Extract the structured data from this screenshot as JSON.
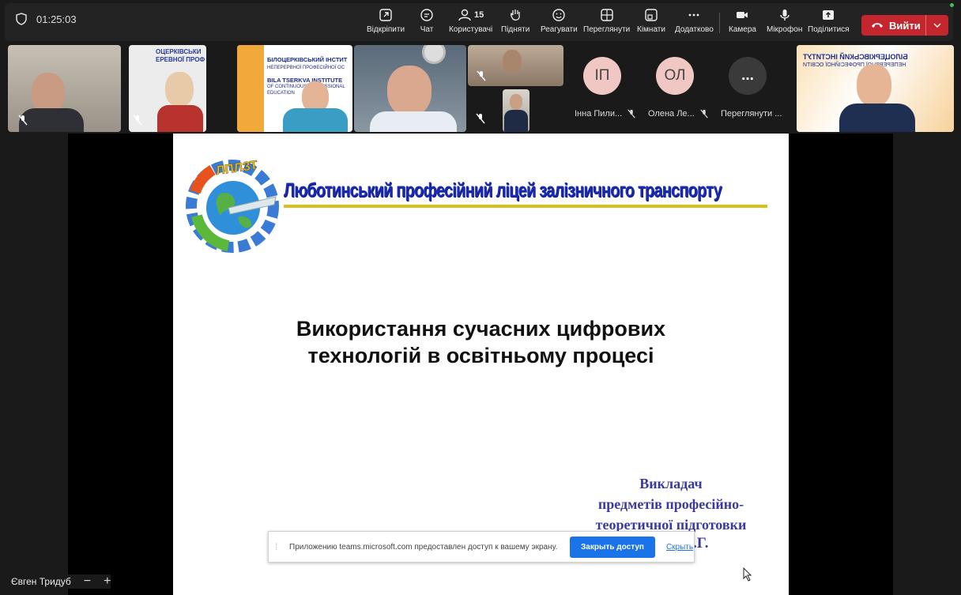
{
  "meeting": {
    "timer": "01:25:03"
  },
  "toolbar": {
    "items": [
      {
        "label": "Відкріпити",
        "icon": "popout-icon"
      },
      {
        "label": "Чат",
        "icon": "chat-icon"
      },
      {
        "label": "Користувачі",
        "icon": "people-icon",
        "badge": "15"
      },
      {
        "label": "Підняти",
        "icon": "raise-hand-icon"
      },
      {
        "label": "Реагувати",
        "icon": "react-icon"
      },
      {
        "label": "Переглянути",
        "icon": "view-icon"
      },
      {
        "label": "Кімнати",
        "icon": "rooms-icon"
      },
      {
        "label": "Додатково",
        "icon": "more-icon"
      },
      {
        "label": "Камера",
        "icon": "camera-icon"
      },
      {
        "label": "Мікрофон",
        "icon": "microphone-icon"
      },
      {
        "label": "Поділитися",
        "icon": "share-icon"
      }
    ],
    "leave_label": "Вийти"
  },
  "participants": {
    "tiles": [
      {
        "initials": "ІП",
        "name": "Інна Пили..."
      },
      {
        "initials": "ОЛ",
        "name": "Олена Ле..."
      },
      {
        "initials": "...",
        "name": "Переглянути ..."
      }
    ],
    "thumb_texts": {
      "t2": "ОЦЕРКІВСЬКИ\nЕРЕВНОЇ ПРОФ",
      "t3a": "БІЛОЦЕРКІВСЬКИЙ ІНСТИТ",
      "t3b": "НЕПЕРЕРВНОЇ ПРОФЕСІЙНОЇ ОС",
      "t3c": "BILA TSERKVA INSTITUTE",
      "t3d": "OF CONTINUOUS PROFESSIONAL",
      "t3e": "EDUCATION",
      "t6a": "БІЛОЦЕРКІВСЬКИЙ ІНСТИТУТ",
      "t6b": "НЕПЕРЕРВНОЇ ПРОФЕСІЙНОЇ ОСВІТИ"
    }
  },
  "slide": {
    "header": "Люботинський професійний ліцей залізничного транспорту",
    "logo_text": "ЛПЛЗТ",
    "headline_line1": "Використання сучасних цифрових",
    "headline_line2": "технологій в освітньому процесі",
    "teacher_line1": "Викладач",
    "teacher_line2": "предметів професійно-",
    "teacher_line3": "теоретичної підготовки",
    "teacher_suffix": ".Г."
  },
  "share_banner": {
    "message": "Приложению teams.microsoft.com предоставлен доступ к вашему экрану.",
    "stop_label": "Закрыть доступ",
    "hide_label": "Скрыть"
  },
  "presenter": {
    "name": "Євген Тридуб",
    "zoom_out": "−",
    "zoom_in": "+"
  }
}
